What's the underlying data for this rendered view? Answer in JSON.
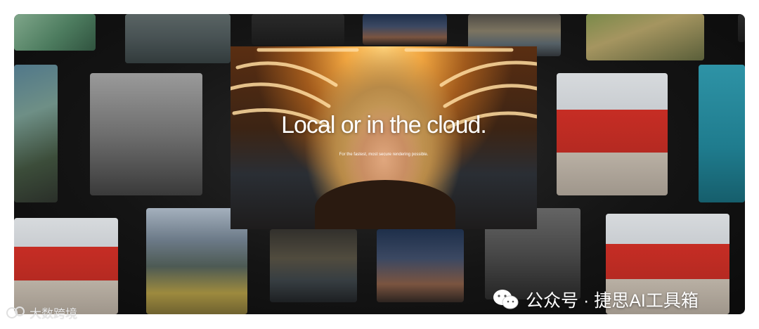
{
  "hero": {
    "title": "Local or in the cloud.",
    "subtitle": "For the fastest, most secure rendering possible."
  },
  "watermark_left": {
    "text": "大数跨境",
    "icon": "chat-bubble-icon"
  },
  "watermark_right": {
    "text": "公众号 · 捷思AI工具箱",
    "icon": "wechat-icon"
  },
  "colors": {
    "background": "#ffffff",
    "gallery": "#111111",
    "text": "#ffffff"
  }
}
